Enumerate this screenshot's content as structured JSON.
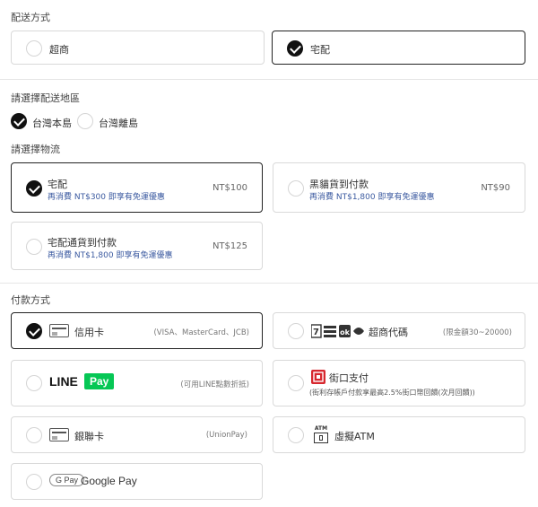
{
  "delivery_method": {
    "title": "配送方式",
    "options": [
      {
        "label": "超商",
        "selected": false
      },
      {
        "label": "宅配",
        "selected": true
      }
    ]
  },
  "delivery_region": {
    "title": "請選擇配送地區",
    "options": [
      {
        "label": "台灣本島",
        "selected": true
      },
      {
        "label": "台灣離島",
        "selected": false
      }
    ]
  },
  "logistics": {
    "title": "請選擇物流",
    "options": [
      {
        "label": "宅配",
        "sub": "再消費 NT$300 即享有免運優惠",
        "price": "NT$100",
        "selected": true
      },
      {
        "label": "黑貓貨到付款",
        "sub": "再消費 NT$1,800 即享有免運優惠",
        "price": "NT$90",
        "selected": false
      },
      {
        "label": "宅配通貨到付款",
        "sub": "再消費 NT$1,800 即享有免運優惠",
        "price": "NT$125",
        "selected": false
      }
    ]
  },
  "payment": {
    "title": "付款方式",
    "options": [
      {
        "label": "信用卡",
        "note": "(VISA、MasterCard、JCB)",
        "selected": true
      },
      {
        "label": "超商代碼",
        "note": "(限金額30~20000)",
        "selected": false
      },
      {
        "label": "LINE",
        "badge": "Pay",
        "note": "(可用LINE點數折抵)",
        "selected": false
      },
      {
        "label": "街口支付",
        "note": "(街利存帳戶付款享最高2.5%街口幣回饋(次月回饋))",
        "selected": false
      },
      {
        "label": "銀聯卡",
        "note": "(UnionPay)",
        "selected": false
      },
      {
        "label": "虛擬ATM",
        "icon_text": "ATM",
        "selected": false
      },
      {
        "label": "Google Pay",
        "badge": "G Pay",
        "selected": false
      }
    ]
  },
  "colors": {
    "accent": "#111111",
    "line_green": "#06c755",
    "jko_red": "#d7282f",
    "sub_text": "#3b5aa0"
  }
}
